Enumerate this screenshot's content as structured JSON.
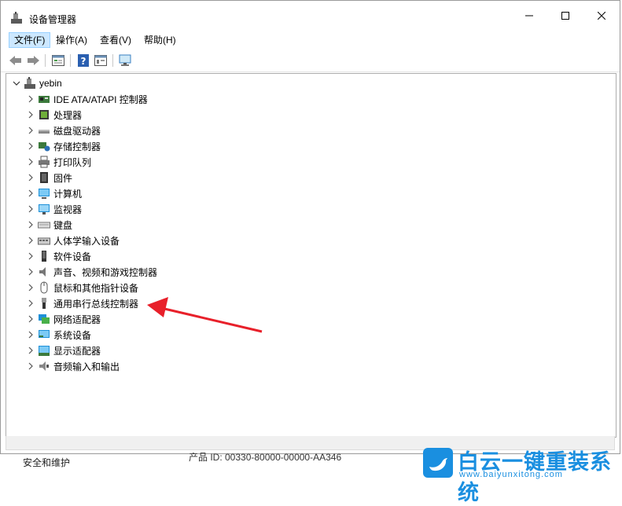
{
  "window": {
    "title": "设备管理器"
  },
  "menu": {
    "items": [
      "文件(F)",
      "操作(A)",
      "查看(V)",
      "帮助(H)"
    ]
  },
  "tree": {
    "root": "yebin",
    "categories": [
      {
        "label": "IDE ATA/ATAPI 控制器",
        "icon": "ide-controller-icon"
      },
      {
        "label": "处理器",
        "icon": "processor-icon"
      },
      {
        "label": "磁盘驱动器",
        "icon": "disk-drive-icon"
      },
      {
        "label": "存储控制器",
        "icon": "storage-controller-icon"
      },
      {
        "label": "打印队列",
        "icon": "printer-icon"
      },
      {
        "label": "固件",
        "icon": "firmware-icon"
      },
      {
        "label": "计算机",
        "icon": "computer-icon"
      },
      {
        "label": "监视器",
        "icon": "monitor-icon"
      },
      {
        "label": "键盘",
        "icon": "keyboard-icon"
      },
      {
        "label": "人体学输入设备",
        "icon": "hid-icon"
      },
      {
        "label": "软件设备",
        "icon": "software-device-icon"
      },
      {
        "label": "声音、视频和游戏控制器",
        "icon": "speaker-icon"
      },
      {
        "label": "鼠标和其他指针设备",
        "icon": "mouse-icon"
      },
      {
        "label": "通用串行总线控制器",
        "icon": "usb-icon"
      },
      {
        "label": "网络适配器",
        "icon": "network-adapter-icon"
      },
      {
        "label": "系统设备",
        "icon": "system-device-icon"
      },
      {
        "label": "显示适配器",
        "icon": "display-adapter-icon"
      },
      {
        "label": "音频输入和输出",
        "icon": "audio-io-icon"
      }
    ]
  },
  "background": {
    "left_text": "安全和维护",
    "mid_text": "产品 ID: 00330-80000-00000-AA346"
  },
  "watermark": {
    "title": "白云一键重装系统",
    "url": "www.baiyunxitong.com"
  },
  "colors": {
    "accent": "#1a8fe0",
    "arrow": "#e8202a",
    "menu_active": "#cce8ff"
  }
}
